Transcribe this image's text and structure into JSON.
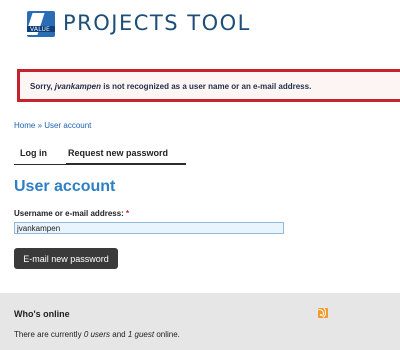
{
  "header": {
    "logo_tag": "VALUE",
    "site_name": "PROJECTS TOOL"
  },
  "error": {
    "prefix": "Sorry, ",
    "username": "jvankampen",
    "suffix": " is not recognized as a user name or an e-mail address."
  },
  "breadcrumb": {
    "home": "Home",
    "separator": " » ",
    "current": "User account"
  },
  "tabs": {
    "login": "Log in",
    "request": "Request new password"
  },
  "page_title": "User account",
  "form": {
    "label": "Username or e-mail address:",
    "required_mark": " *",
    "value": "jvankampen",
    "submit": "E-mail new password"
  },
  "online": {
    "title": "Who's online",
    "text_prefix": "There are currently ",
    "users": "0 users",
    "text_middle": " and ",
    "guests": "1 guest",
    "text_suffix": " online."
  },
  "colors": {
    "accent_blue": "#2e7fc4",
    "error_border": "#c4232c",
    "button_bg": "#3a3a3a",
    "rss_orange": "#f29a2e"
  }
}
